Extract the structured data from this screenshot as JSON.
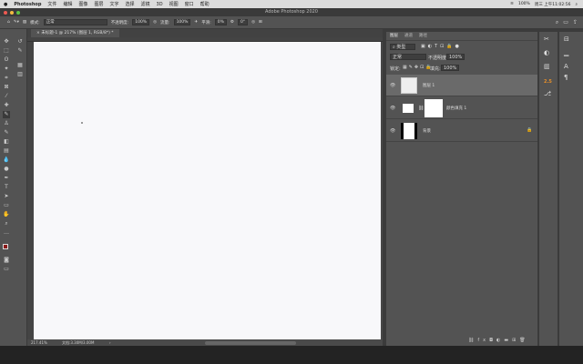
{
  "menubar": {
    "apple": "",
    "app": "Photoshop",
    "items": [
      "文件",
      "编辑",
      "图像",
      "图层",
      "文字",
      "选择",
      "滤镜",
      "3D",
      "视图",
      "窗口",
      "帮助"
    ],
    "battery": "100%",
    "clock": "周三 上午11:02:56"
  },
  "window": {
    "title": "Adobe Photoshop 2020"
  },
  "options": {
    "mode_label": "模式:",
    "mode_value": "正常",
    "opacity_label": "不透明度:",
    "opacity_value": "100%",
    "flow_label": "流量:",
    "flow_value": "100%",
    "smooth_label": "平滑:",
    "smooth_value": "0%",
    "angle_value": "0°"
  },
  "document": {
    "tab": "未标题-1 @ 217% (图层 1, RGB/8*) *",
    "zoom": "217.41%",
    "doc_info": "文档:3.30M/3.00M"
  },
  "layers_panel": {
    "tabs": [
      "图层",
      "通道",
      "路径"
    ],
    "filter": "类型",
    "blend": "正常",
    "opacity_label": "不透明度:",
    "opacity": "100%",
    "lock_label": "锁定:",
    "fill_label": "填充:",
    "fill": "100%",
    "layers": [
      {
        "name": "图层 1",
        "selected": true
      },
      {
        "name": "颜色填充 1",
        "selected": false
      },
      {
        "name": "背景",
        "selected": false,
        "locked": true
      }
    ]
  },
  "side_icons": {
    "badge": "2.5"
  },
  "colors": {
    "canvas": "#f8f8fa",
    "panel": "#535353",
    "selected_layer": "#6a6a6a",
    "foreground": "#8b1a1a",
    "accent": "#e8902a"
  }
}
